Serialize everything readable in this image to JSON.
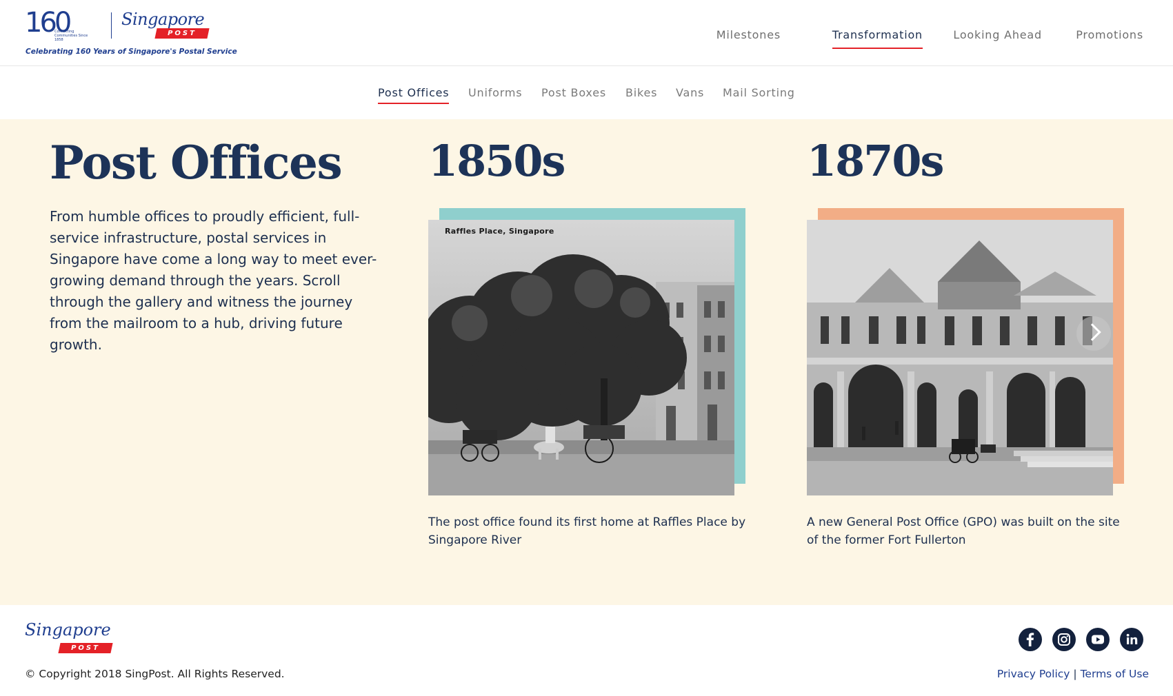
{
  "brand": {
    "logo_number": "160",
    "logo_tagline": "Connecting Communities Since 1858",
    "script_name": "Singapore",
    "post_badge": "POST",
    "celebrating": "Celebrating 160 Years of Singapore's Postal Service"
  },
  "topnav": {
    "items": [
      {
        "label": "Milestones",
        "active": false
      },
      {
        "label": "Transformation",
        "active": true
      },
      {
        "label": "Looking Ahead",
        "active": false
      },
      {
        "label": "Promotions",
        "active": false
      }
    ]
  },
  "subnav": {
    "items": [
      {
        "label": "Post Offices",
        "active": true
      },
      {
        "label": "Uniforms",
        "active": false
      },
      {
        "label": "Post Boxes",
        "active": false
      },
      {
        "label": "Bikes",
        "active": false
      },
      {
        "label": "Vans",
        "active": false
      },
      {
        "label": "Mail Sorting",
        "active": false
      }
    ]
  },
  "main": {
    "title": "Post Offices",
    "intro": "From humble offices to proudly efficient, full-service infrastructure, postal services in Singapore have come a long way to meet ever-growing demand through the years. Scroll through the gallery and witness the journey from the mailroom to a hub, driving future growth.",
    "eras": [
      {
        "year": "1850s",
        "photo_label": "Raffles Place, Singapore",
        "caption": "The post office found its first home at Raffles Place by Singapore River",
        "accent_color": "#8fcfcd"
      },
      {
        "year": "1870s",
        "photo_label": "",
        "caption": "A new General Post Office (GPO) was built on the site of the former Fort Fullerton",
        "accent_color": "#f2ad86"
      }
    ],
    "carousel_next_icon": "chevron-right-icon"
  },
  "footer": {
    "script_name": "Singapore",
    "post_badge": "POST",
    "copyright": "© Copyright 2018 SingPost. All Rights Reserved.",
    "privacy": "Privacy Policy",
    "separator": "|",
    "terms": "Terms of Use",
    "social": [
      "facebook-icon",
      "instagram-icon",
      "youtube-icon",
      "linkedin-icon"
    ]
  },
  "colors": {
    "brand_red": "#e42127",
    "brand_blue": "#1f3e8f",
    "navy": "#1d3358",
    "cream": "#fdf6e5"
  }
}
